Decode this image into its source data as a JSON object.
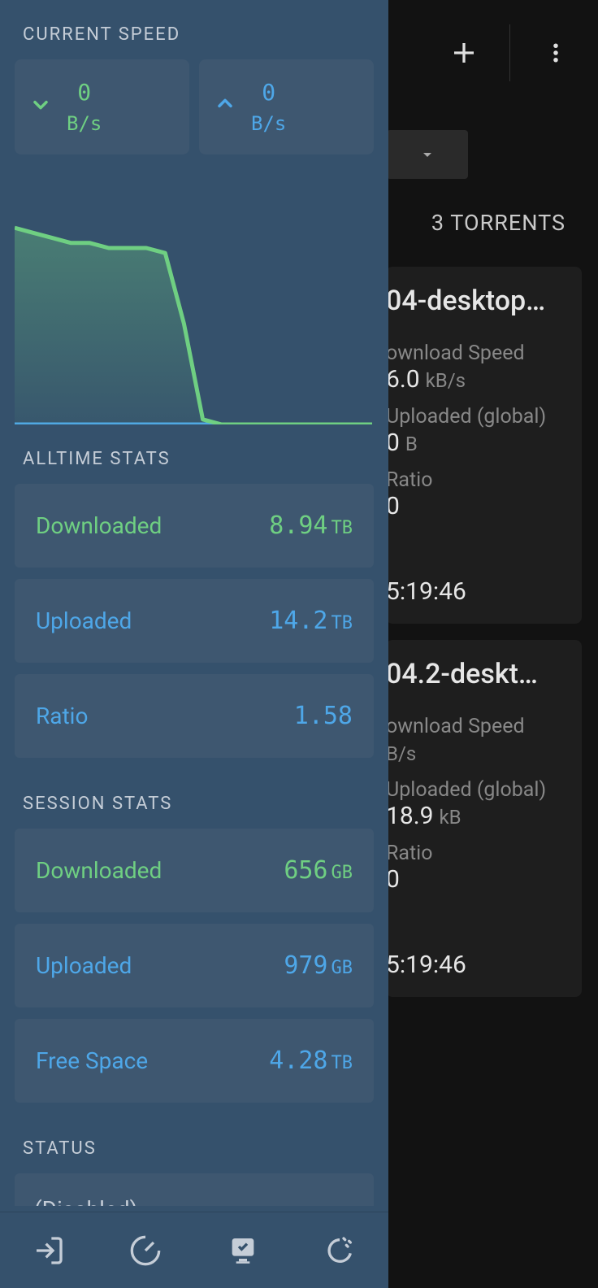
{
  "header": {
    "torrent_count": "3 TORRENTS"
  },
  "torrents": [
    {
      "title": "04-desktop…",
      "dl_label": "ownload Speed",
      "dl_value": "6.0",
      "dl_unit": "kB/s",
      "up_label": "Uploaded (global)",
      "up_value": "0",
      "up_unit": "B",
      "ratio_label": "Ratio",
      "ratio_value": "0",
      "eta": "5:19:46"
    },
    {
      "title": "04.2-deskt…",
      "dl_label": "ownload Speed",
      "dl_value": "",
      "dl_unit": "B/s",
      "up_label": "Uploaded (global)",
      "up_value": "18.9",
      "up_unit": "kB",
      "ratio_label": "Ratio",
      "ratio_value": "0",
      "eta": "5:19:46"
    }
  ],
  "sidebar": {
    "current_speed_label": "CURRENT SPEED",
    "down_value": "0",
    "down_unit": "B/s",
    "up_value": "0",
    "up_unit": "B/s",
    "alltime_label": "ALLTIME STATS",
    "alltime": {
      "downloaded_label": "Downloaded",
      "downloaded_value": "8.94",
      "downloaded_unit": "TB",
      "uploaded_label": "Uploaded",
      "uploaded_value": "14.2",
      "uploaded_unit": "TB",
      "ratio_label": "Ratio",
      "ratio_value": "1.58"
    },
    "session_label": "SESSION STATS",
    "session": {
      "downloaded_label": "Downloaded",
      "downloaded_value": "656",
      "downloaded_unit": "GB",
      "uploaded_label": "Uploaded",
      "uploaded_value": "979",
      "uploaded_unit": "GB",
      "freespace_label": "Free Space",
      "freespace_value": "4.28",
      "freespace_unit": "TB"
    },
    "status_label": "STATUS",
    "status_value": "(Disabled)"
  },
  "chart_data": {
    "type": "area",
    "title": "",
    "xlabel": "",
    "ylabel": "",
    "series": [
      {
        "name": "download",
        "color": "#6fcf82",
        "values": [
          78,
          76,
          74,
          72,
          72,
          70,
          70,
          70,
          68,
          40,
          2,
          0,
          0,
          0,
          0,
          0,
          0,
          0,
          0,
          0
        ]
      },
      {
        "name": "upload",
        "color": "#4ea7e8",
        "values": [
          0,
          0,
          0,
          0,
          0,
          0,
          0,
          0,
          0,
          0,
          0,
          0,
          0,
          0,
          0,
          0,
          0,
          0,
          0,
          0
        ]
      }
    ],
    "ylim": [
      0,
      100
    ]
  }
}
